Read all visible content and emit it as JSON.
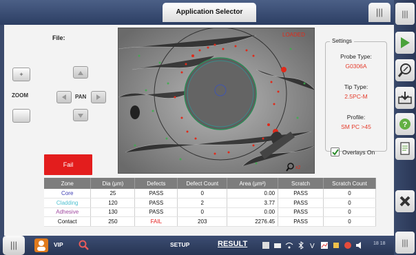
{
  "header": {
    "title": "Application Selector",
    "menu_icon": "triple-bar-icon"
  },
  "left_controls": {
    "file_label": "File:",
    "zoom_label": "ZOOM",
    "zoom_in": "+",
    "pan_label": "PAN",
    "result_label": "Fail"
  },
  "scope": {
    "status": "LOADED",
    "zoom_text": "x2"
  },
  "settings": {
    "title": "Settings",
    "probe_label": "Probe Type:",
    "probe_value": "G0306A",
    "tip_label": "Tip Type:",
    "tip_value": "2.5PC-M",
    "profile_label": "Profile:",
    "profile_value": "SM PC >45",
    "overlays_label": "Overlays On",
    "overlays_checked": true
  },
  "table": {
    "headers": [
      "Zone",
      "Dia (μm)",
      "Defects",
      "Defect Count",
      "Area (μm²)",
      "Scratch",
      "Scratch Count"
    ],
    "rows": [
      {
        "zone": "Core",
        "dia": "25",
        "defects": "PASS",
        "count": "0",
        "area": "0.00",
        "scratch": "PASS",
        "scount": "0"
      },
      {
        "zone": "Cladding",
        "dia": "120",
        "defects": "PASS",
        "count": "2",
        "area": "3.77",
        "scratch": "PASS",
        "scount": "0"
      },
      {
        "zone": "Adhesive",
        "dia": "130",
        "defects": "PASS",
        "count": "0",
        "area": "0.00",
        "scratch": "PASS",
        "scount": "0"
      },
      {
        "zone": "Contact",
        "dia": "250",
        "defects": "FAIL",
        "count": "203",
        "area": "2276.45",
        "scratch": "PASS",
        "scount": "0"
      }
    ]
  },
  "bottom": {
    "vip": "VIP",
    "setup": "SETUP",
    "result": "RESULT",
    "time1": "18",
    "time2": "18"
  },
  "colors": {
    "fail": "#e31d1d",
    "core": "#3b3bb3",
    "cladding": "#4fc0d0",
    "adhesive": "#a04aa0",
    "accent_red": "#e43b2b"
  }
}
